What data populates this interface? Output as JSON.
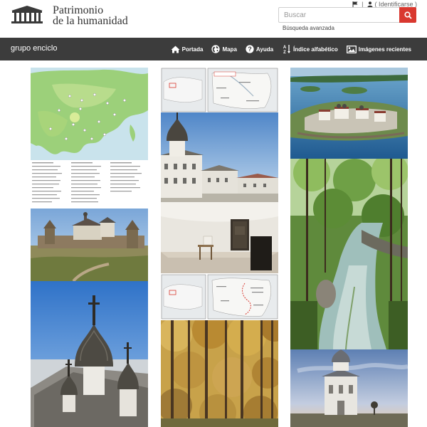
{
  "site": {
    "title_line1": "Patrimonio",
    "title_line2": "de la humanidad"
  },
  "topbar": {
    "identify_label": "( Identificarse )"
  },
  "search": {
    "placeholder": "Buscar",
    "advanced_label": "Búsqueda avanzada"
  },
  "navbar": {
    "brand": "grupo enciclo",
    "items": [
      {
        "label": "Portada",
        "icon": "home-icon"
      },
      {
        "label": "Mapa",
        "icon": "globe-icon"
      },
      {
        "label": "Ayuda",
        "icon": "help-icon"
      },
      {
        "label": "Índice alfabético",
        "icon": "sort-alpha-icon"
      },
      {
        "label": "Imágenes recientes",
        "icon": "image-icon"
      }
    ]
  },
  "colors": {
    "accent": "#d9382f",
    "navbar": "#3c3c3c",
    "text": "#333333"
  },
  "gallery": {
    "tiles": [
      {
        "name": "tile-asia-map",
        "subject": "map"
      },
      {
        "name": "tile-legend-list",
        "subject": "document"
      },
      {
        "name": "tile-fortress-landscape",
        "subject": "photo"
      },
      {
        "name": "tile-onion-domes",
        "subject": "photo"
      },
      {
        "name": "tile-locator-map-1",
        "subject": "map"
      },
      {
        "name": "tile-white-monastery",
        "subject": "photo"
      },
      {
        "name": "tile-interior-room",
        "subject": "photo"
      },
      {
        "name": "tile-locator-map-2",
        "subject": "map"
      },
      {
        "name": "tile-autumn-forest",
        "subject": "photo"
      },
      {
        "name": "tile-island-aerial",
        "subject": "photo"
      },
      {
        "name": "tile-forest-canal",
        "subject": "photo"
      },
      {
        "name": "tile-chapel-dusk",
        "subject": "photo"
      }
    ]
  }
}
